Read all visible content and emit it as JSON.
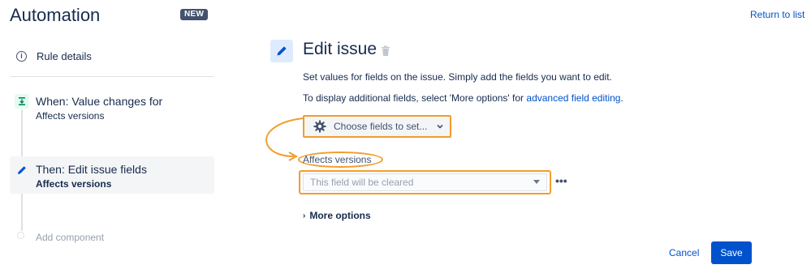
{
  "header": {
    "app_title": "Automation",
    "badge": "NEW",
    "return_link": "Return to list"
  },
  "sidebar": {
    "rule_details": {
      "label": "Rule details",
      "icon": "info-icon"
    },
    "trigger": {
      "title": "When: Value changes for",
      "subtitle": "Affects versions",
      "icon": "trigger-icon"
    },
    "action": {
      "title": "Then: Edit issue fields",
      "subtitle": "Affects versions",
      "icon": "pencil-icon"
    },
    "add_component": "Add component"
  },
  "main": {
    "title": "Edit issue",
    "description": "Set values for fields on the issue. Simply add the fields you want to edit.",
    "advanced_prefix": "To display additional fields, select 'More options' for ",
    "advanced_link": "advanced field editing",
    "advanced_suffix": ".",
    "choose_fields_button": "Choose fields to set...",
    "field_label": "Affects versions",
    "field_placeholder": "This field will be cleared",
    "more_options": "More options",
    "more_options_arrow": "›",
    "field_menu_glyph": "•••",
    "cancel": "Cancel",
    "save": "Save"
  },
  "colors": {
    "primary": "#0052cc",
    "annotation": "#f29d2c",
    "text": "#172b4d",
    "muted": "#97a0af",
    "trigger_green": "#00875a"
  }
}
